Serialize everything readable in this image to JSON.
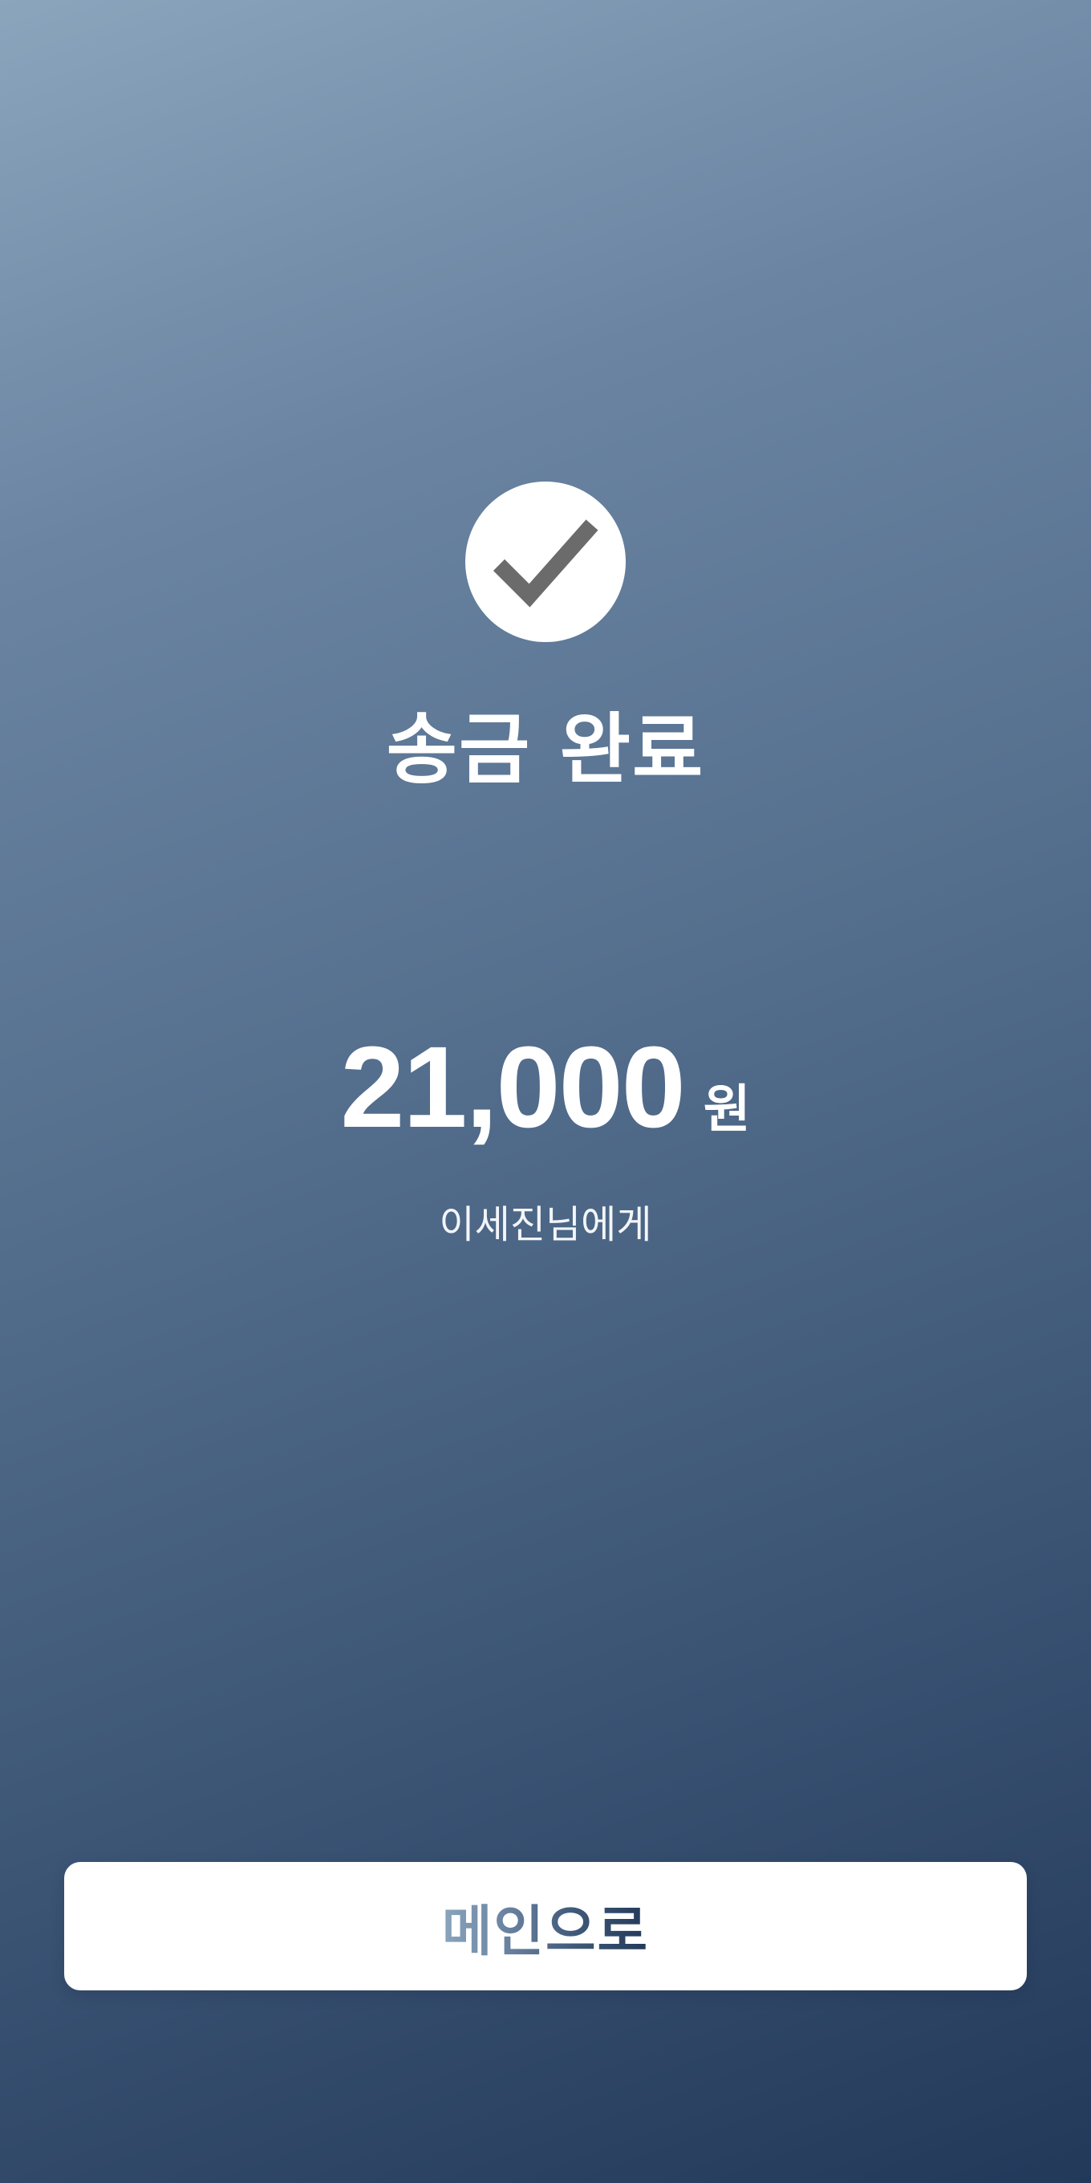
{
  "status": {
    "icon": "check-icon",
    "title": "송금 완료"
  },
  "transfer": {
    "amount": "21,000",
    "currency_unit": "원",
    "recipient_text": "이세진님에게"
  },
  "actions": {
    "main_button_label": "메인으로"
  },
  "colors": {
    "background_top": "#8ba5bd",
    "background_bottom": "#23395a",
    "check_mark": "#6b6b6b",
    "button_background": "#ffffff"
  }
}
